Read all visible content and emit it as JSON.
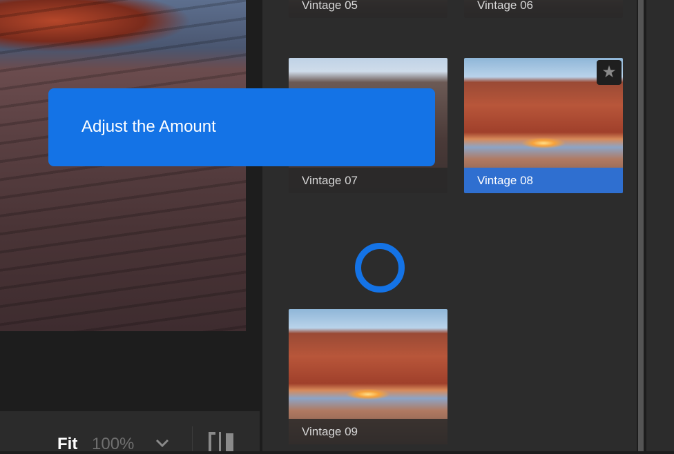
{
  "viewer": {
    "fit_label": "Fit",
    "zoom_level": "100%"
  },
  "tooltip": {
    "text": "Adjust the Amount"
  },
  "presets": [
    {
      "label": "Vintage 05"
    },
    {
      "label": "Vintage 06"
    },
    {
      "label": "Vintage 07"
    },
    {
      "label": "Vintage 08",
      "selected": true,
      "starred": true
    },
    {
      "label": "Vintage 09"
    }
  ],
  "icons": {
    "star": "★"
  },
  "colors": {
    "accent": "#1473e6",
    "selected_label": "#2f6fd0"
  }
}
